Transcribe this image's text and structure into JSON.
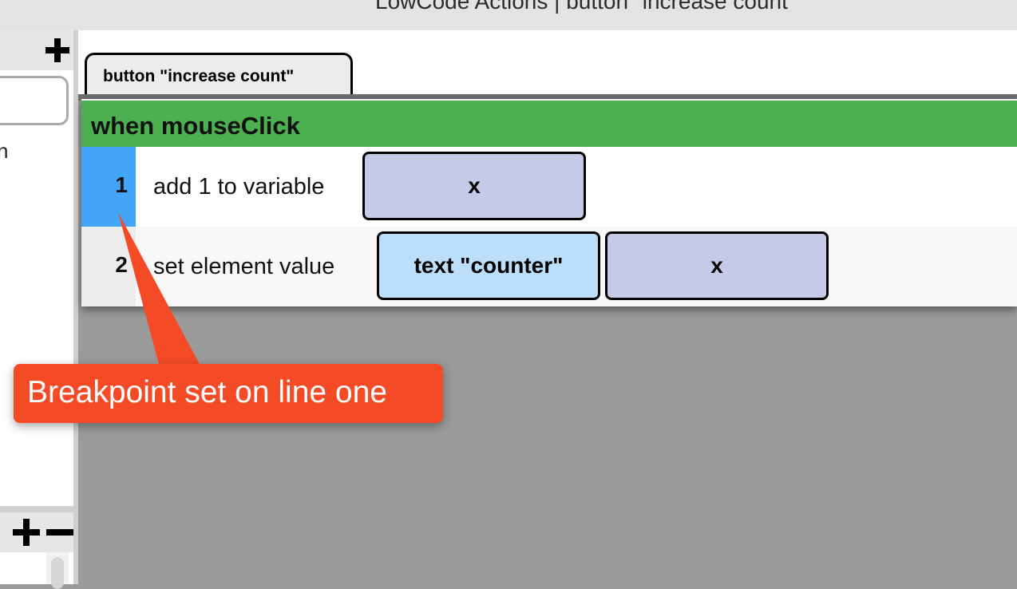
{
  "window": {
    "title": "LowCode Actions | button \"increase count\""
  },
  "sidebar": {
    "list_partial_text": "n"
  },
  "editor": {
    "tab_label": "button \"increase count\"",
    "event_header": "when mouseClick",
    "lines": [
      {
        "number": "1",
        "statement": "add 1 to variable",
        "breakpoint": true,
        "args": [
          {
            "kind": "variable",
            "label": "x"
          }
        ]
      },
      {
        "number": "2",
        "statement": "set element value",
        "breakpoint": false,
        "args": [
          {
            "kind": "element",
            "label": "text \"counter\""
          },
          {
            "kind": "variable",
            "label": "x"
          }
        ]
      }
    ]
  },
  "annotation": {
    "text": "Breakpoint set on line one"
  },
  "colors": {
    "event_header": "#4caf50",
    "breakpoint_gutter": "#42a5f5",
    "variable_arg": "#c5cae9",
    "element_arg": "#bbdefb",
    "callout": "#f44a26"
  },
  "icons": {
    "sidebar_add": "plus-icon",
    "bottom_add": "plus-icon",
    "bottom_remove": "minus-icon"
  }
}
